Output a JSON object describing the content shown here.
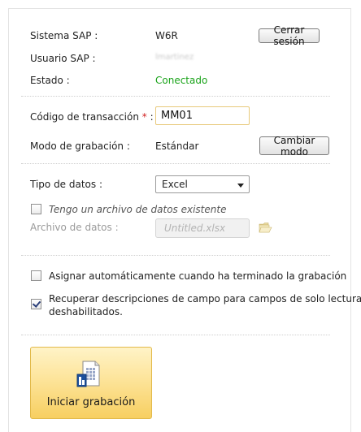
{
  "connection": {
    "system_label": "Sistema SAP :",
    "system_value": "W6R",
    "logout_label": "Cerrar sesión",
    "user_label": "Usuario SAP :",
    "user_value": "lmartinez",
    "status_label": "Estado :",
    "status_value": "Conectado",
    "status_color": "#19a319"
  },
  "recording": {
    "transaction_label": "Código de transacción",
    "required_marker": "*",
    "transaction_suffix": ":",
    "transaction_value": "MM01",
    "mode_label": "Modo de grabación :",
    "mode_value": "Estándar",
    "change_mode_label": "Cambiar modo"
  },
  "data": {
    "type_label": "Tipo de datos :",
    "type_value": "Excel",
    "existing_file_label": "Tengo un archivo de datos existente",
    "existing_file_checked": false,
    "file_label": "Archivo de datos :",
    "file_placeholder": "Untitled.xlsx"
  },
  "options": {
    "auto_assign_label": "Asignar automáticamente cuando ha terminado la grabación",
    "auto_assign_checked": false,
    "retrieve_desc_line1": "Recuperar descripciones de campo para campos de solo lectura y",
    "retrieve_desc_line2": "deshabilitados.",
    "retrieve_desc_checked": true
  },
  "actions": {
    "start_label": "Iniciar grabación",
    "start_icon": "recording-document-icon",
    "accent_color": "#f7cf61"
  }
}
